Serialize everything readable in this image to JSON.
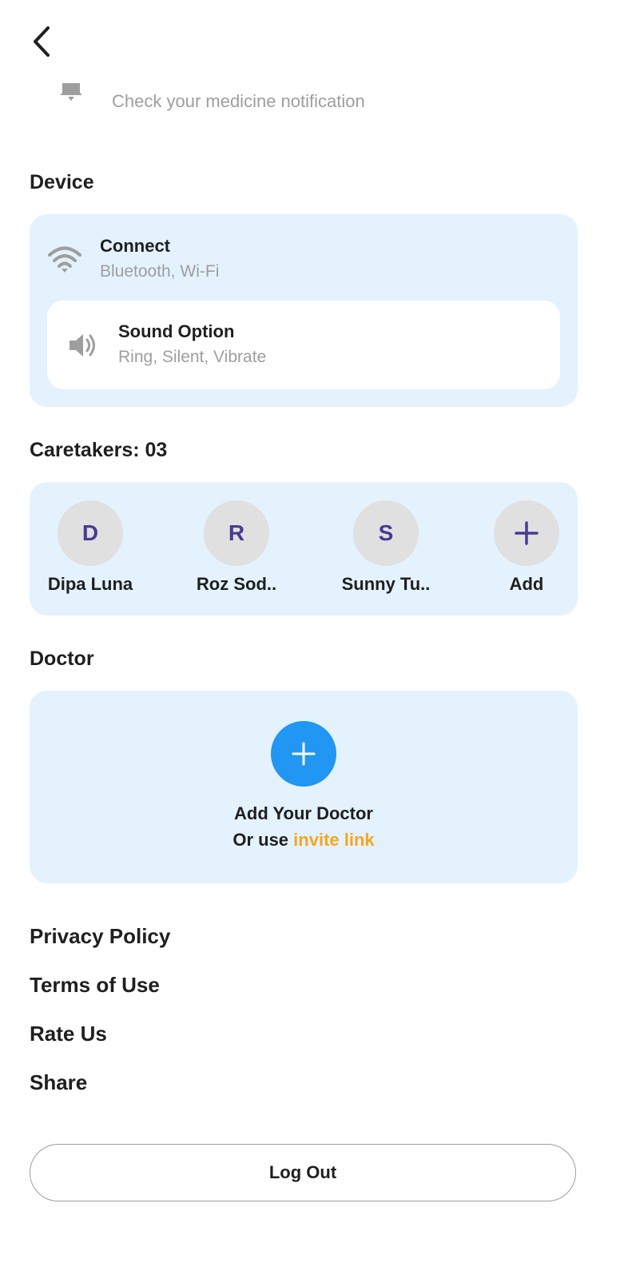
{
  "header": {
    "back_icon": "chevron-left-icon",
    "notification_icon": "bell-icon",
    "notification_text": "Check your medicine notification"
  },
  "device": {
    "title": "Device",
    "connect": {
      "icon": "wifi-icon",
      "title": "Connect",
      "subtitle": "Bluetooth, Wi-Fi"
    },
    "sound": {
      "icon": "speaker-icon",
      "title": "Sound Option",
      "subtitle": "Ring, Silent, Vibrate"
    }
  },
  "caretakers": {
    "title": "Caretakers: 03",
    "items": [
      {
        "initial": "D",
        "name": "Dipa Luna"
      },
      {
        "initial": "R",
        "name": "Roz Sod.."
      },
      {
        "initial": "S",
        "name": "Sunny Tu.."
      }
    ],
    "add_label": "Add",
    "add_icon": "plus-icon"
  },
  "doctor": {
    "title": "Doctor",
    "add_icon": "plus-icon",
    "add_label": "Add Your Doctor",
    "or_use": "Or use",
    "invite_link": "invite link"
  },
  "menu": {
    "privacy": "Privacy Policy",
    "terms": "Terms of Use",
    "rate": "Rate Us",
    "share": "Share"
  },
  "logout_label": "Log Out",
  "colors": {
    "card_bg": "#e3f2fd",
    "accent_blue": "#2196f3",
    "link_orange": "#f5a623",
    "initial_purple": "#4a3b8f",
    "muted_text": "#9e9e9e"
  }
}
